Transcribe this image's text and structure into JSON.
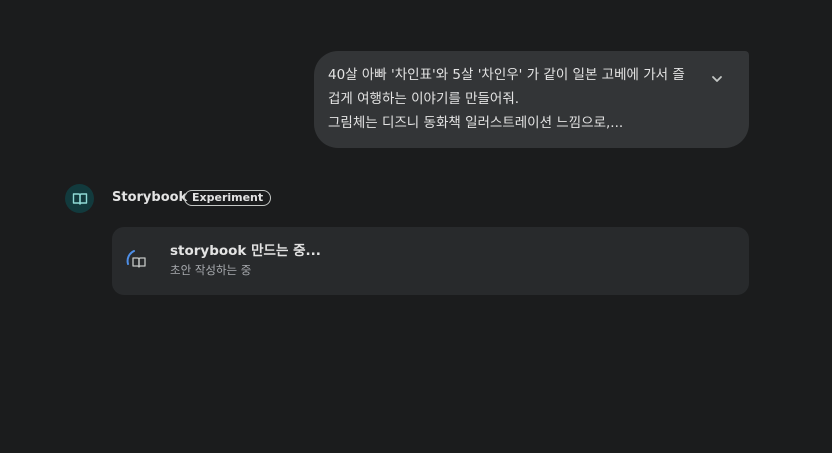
{
  "user_message": {
    "lines": [
      "40살 아빠 '차인표'와 5살 '차인우' 가 같이 일본 고베에 가서 즐",
      "겁게 여행하는 이야기를 만들어줘.",
      "그림체는 디즈니 동화책 일러스트레이션 느낌으로,..."
    ],
    "expand_icon": "chevron-down-icon"
  },
  "response": {
    "avatar_icon": "book-icon",
    "name": "Storybook",
    "badge": "Experiment",
    "progress": {
      "icon": "loading-book-icon",
      "title": "storybook 만드는 중...",
      "subtitle": "초안 작성하는 중"
    }
  },
  "colors": {
    "background": "#1b1c1d",
    "bubble": "#333537",
    "card": "#282a2c",
    "accent_teal": "#8fd9d5",
    "spinner_blue": "#4e8fe8"
  }
}
